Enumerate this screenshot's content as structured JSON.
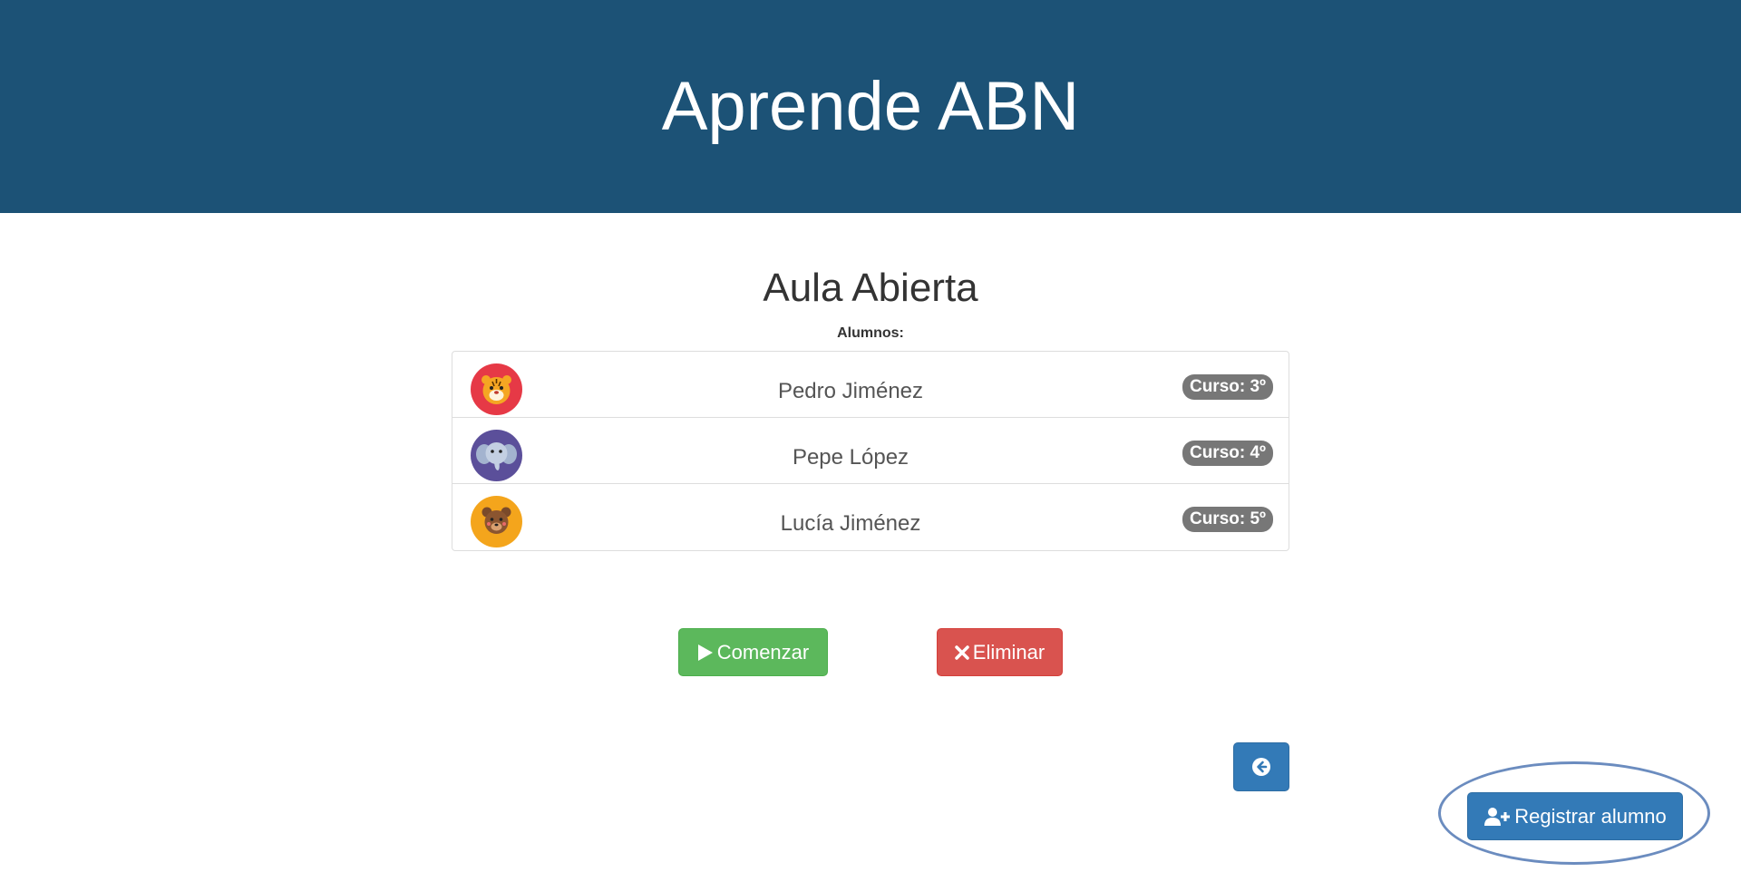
{
  "header": {
    "title": "Aprende ABN"
  },
  "classroom": {
    "title": "Aula Abierta",
    "students_label": "Alumnos:"
  },
  "students": [
    {
      "name": "Pedro Jiménez",
      "grade": "Curso: 3º",
      "avatar": "tiger-avatar-icon",
      "avatar_color": "#e63946"
    },
    {
      "name": "Pepe López",
      "grade": "Curso: 4º",
      "avatar": "elephant-avatar-icon",
      "avatar_color": "#5b4f9a"
    },
    {
      "name": "Lucía Jiménez",
      "grade": "Curso: 5º",
      "avatar": "bear-avatar-icon",
      "avatar_color": "#f4a51c"
    }
  ],
  "actions": {
    "start_label": "Comenzar",
    "delete_label": "Eliminar",
    "register_label": "Registrar alumno",
    "back_icon": "arrow-circle-left-icon"
  },
  "colors": {
    "header_bg": "#1c5276",
    "start": "#5cb85c",
    "delete": "#d9534f",
    "primary": "#337ab7",
    "badge": "#777777"
  }
}
